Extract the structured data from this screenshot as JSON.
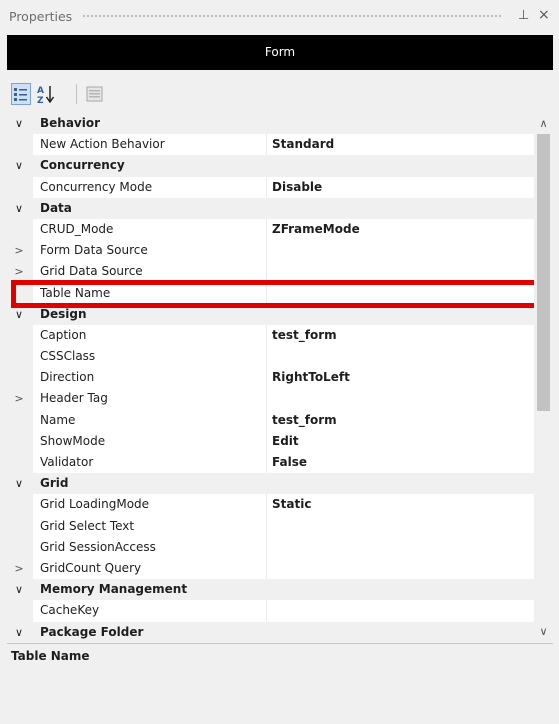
{
  "panel": {
    "title": "Properties",
    "pin_glyph": "⊥",
    "close_glyph": "×"
  },
  "object_selector": {
    "value": "Form"
  },
  "toolbar": {
    "buttons": [
      {
        "name": "categorized-icon",
        "active": true
      },
      {
        "name": "alphabetical-icon",
        "active": false
      },
      {
        "name": "property-pages-icon",
        "active": false
      }
    ]
  },
  "grid": {
    "rows": [
      {
        "type": "category",
        "label": "Behavior",
        "expander": "∨"
      },
      {
        "type": "property",
        "label": "New Action Behavior",
        "value": "Standard",
        "expander": ""
      },
      {
        "type": "category",
        "label": "Concurrency",
        "expander": "∨"
      },
      {
        "type": "property",
        "label": "Concurrency Mode",
        "value": "Disable",
        "expander": ""
      },
      {
        "type": "category",
        "label": "Data",
        "expander": "∨"
      },
      {
        "type": "property",
        "label": "CRUD_Mode",
        "value": "ZFrameMode",
        "expander": ""
      },
      {
        "type": "property",
        "label": "Form Data Source",
        "value": "",
        "expander": ">"
      },
      {
        "type": "property",
        "label": "Grid Data Source",
        "value": "",
        "expander": ">"
      },
      {
        "type": "property",
        "label": "Table Name",
        "value": "",
        "expander": "",
        "selected": true
      },
      {
        "type": "category",
        "label": "Design",
        "expander": "∨"
      },
      {
        "type": "property",
        "label": "Caption",
        "value": "test_form",
        "expander": ""
      },
      {
        "type": "property",
        "label": "CSSClass",
        "value": "",
        "expander": ""
      },
      {
        "type": "property",
        "label": "Direction",
        "value": "RightToLeft",
        "expander": ""
      },
      {
        "type": "property",
        "label": "Header Tag",
        "value": "",
        "expander": ">"
      },
      {
        "type": "property",
        "label": "Name",
        "value": "test_form",
        "expander": ""
      },
      {
        "type": "property",
        "label": "ShowMode",
        "value": "Edit",
        "expander": ""
      },
      {
        "type": "property",
        "label": "Validator",
        "value": "False",
        "expander": ""
      },
      {
        "type": "category",
        "label": "Grid",
        "expander": "∨"
      },
      {
        "type": "property",
        "label": "Grid LoadingMode",
        "value": "Static",
        "expander": ""
      },
      {
        "type": "property",
        "label": "Grid Select Text",
        "value": "",
        "expander": ""
      },
      {
        "type": "property",
        "label": "Grid SessionAccess",
        "value": "",
        "expander": ""
      },
      {
        "type": "property",
        "label": "GridCount Query",
        "value": "",
        "expander": ">"
      },
      {
        "type": "category",
        "label": "Memory Management",
        "expander": "∨"
      },
      {
        "type": "property",
        "label": "CacheKey",
        "value": "",
        "expander": ""
      },
      {
        "type": "category",
        "label": "Package Folder",
        "expander": "∨"
      }
    ]
  },
  "scrollbar": {
    "up": "∧",
    "down": "∨"
  },
  "description": {
    "title": "Table Name",
    "text": ""
  },
  "colors": {
    "highlight": "#e00000",
    "object_bar": "#000000"
  }
}
